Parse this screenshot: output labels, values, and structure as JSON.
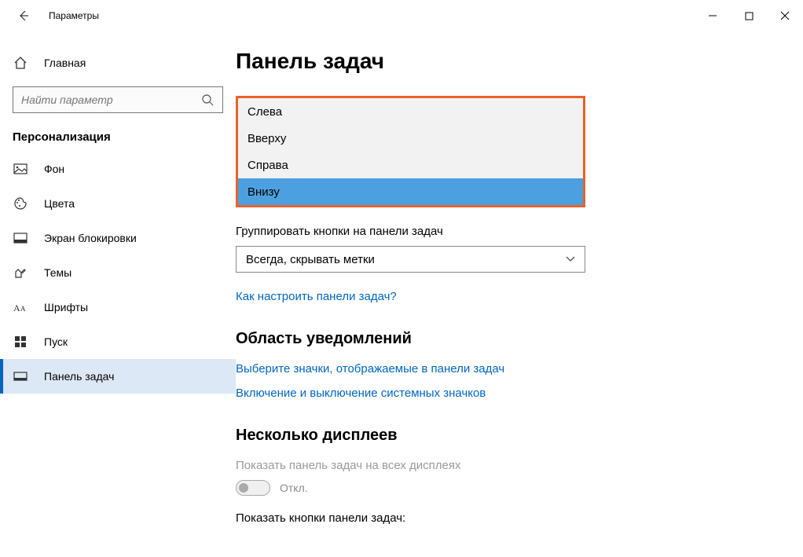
{
  "window": {
    "title": "Параметры"
  },
  "sidebar": {
    "home": "Главная",
    "search_placeholder": "Найти параметр",
    "category": "Персонализация",
    "items": [
      {
        "label": "Фон"
      },
      {
        "label": "Цвета"
      },
      {
        "label": "Экран блокировки"
      },
      {
        "label": "Темы"
      },
      {
        "label": "Шрифты"
      },
      {
        "label": "Пуск"
      },
      {
        "label": "Панель задач"
      }
    ]
  },
  "main": {
    "title": "Панель задач",
    "position_dropdown": {
      "options": [
        "Слева",
        "Вверху",
        "Справа",
        "Внизу"
      ],
      "selected_index": 3
    },
    "group_label": "Группировать кнопки на панели задач",
    "group_value": "Всегда, скрывать метки",
    "link_customize": "Как настроить панели задач?",
    "section_notifications": "Область уведомлений",
    "link_select_icons": "Выберите значки, отображаемые в панели задач",
    "link_system_icons": "Включение и выключение системных значков",
    "section_multi": "Несколько дисплеев",
    "multi_show_label": "Показать панель задач на всех дисплеях",
    "toggle_off": "Откл.",
    "multi_buttons_label": "Показать кнопки панели задач:"
  }
}
